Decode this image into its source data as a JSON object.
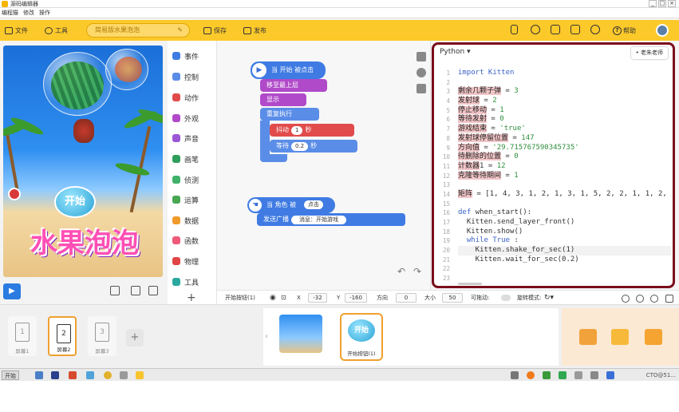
{
  "window": {
    "title": "源码编辑器",
    "buttons": [
      "_",
      "□",
      "×"
    ]
  },
  "menu": [
    "编程猫",
    "修改",
    "操作"
  ],
  "toolbar": {
    "file": "文件",
    "tools": "工具",
    "work_name": "简易版水果泡泡",
    "save": "保存",
    "publish": "发布",
    "help": "帮助"
  },
  "stage": {
    "start_button": "开始",
    "title_art": "水果泡泡"
  },
  "categories": [
    "事件",
    "控制",
    "动作",
    "外观",
    "声音",
    "画笔",
    "侦测",
    "运算",
    "数据",
    "函数",
    "物理",
    "工具"
  ],
  "category_colors": [
    "#3f7be3",
    "#5a8de8",
    "#e14b4b",
    "#b04ac9",
    "#9b58d6",
    "#2e9e5a",
    "#3fb16a",
    "#49a651",
    "#f09a2a",
    "#f05a7a",
    "#e04444",
    "#2aa8a0"
  ],
  "blocks": {
    "group1": {
      "hat": "当 开始 被点击",
      "b1": "移至最上层",
      "b2": "显示",
      "b3": "重复执行",
      "shake": "抖动",
      "shake_val": "1",
      "sec": "秒",
      "wait": "等待",
      "wait_val": "0.2",
      "wait_sec": "秒"
    },
    "group2": {
      "hat": "当 角色 被",
      "hat_opt": "点击",
      "broadcast": "发送广播",
      "msg": "消息：开始游戏"
    }
  },
  "editor": {
    "language": "Python",
    "tutor": "老朱老师",
    "line_numbers": [
      "1",
      "2",
      "3",
      "4",
      "5",
      "6",
      "7",
      "8",
      "9",
      "10",
      "11",
      "12",
      "13",
      "14",
      "15",
      "16",
      "17",
      "18",
      "19",
      "20",
      "21",
      "22",
      "23"
    ],
    "code": [
      [
        {
          "t": "import Kitten",
          "c": "kw"
        }
      ],
      [],
      [
        {
          "t": "剩余几颗子弹",
          "c": "var"
        },
        {
          "t": " = "
        },
        {
          "t": "3",
          "c": "num"
        }
      ],
      [
        {
          "t": "发射球",
          "c": "var"
        },
        {
          "t": " = "
        },
        {
          "t": "2",
          "c": "num"
        }
      ],
      [
        {
          "t": "停止移动",
          "c": "var"
        },
        {
          "t": " = "
        },
        {
          "t": "1",
          "c": "num"
        }
      ],
      [
        {
          "t": "等待发射",
          "c": "var"
        },
        {
          "t": " = "
        },
        {
          "t": "0",
          "c": "num"
        }
      ],
      [
        {
          "t": "游戏结束",
          "c": "var"
        },
        {
          "t": " = "
        },
        {
          "t": "'true'",
          "c": "str"
        }
      ],
      [
        {
          "t": "发射球停留位置",
          "c": "var"
        },
        {
          "t": " = "
        },
        {
          "t": "147",
          "c": "num"
        }
      ],
      [
        {
          "t": "方向值",
          "c": "var"
        },
        {
          "t": " = "
        },
        {
          "t": "'29.715767590345735'",
          "c": "str"
        }
      ],
      [
        {
          "t": "待删除的位置",
          "c": "var"
        },
        {
          "t": " = "
        },
        {
          "t": "0",
          "c": "num"
        }
      ],
      [
        {
          "t": "计数器",
          "c": "var"
        },
        {
          "t": "1 = "
        },
        {
          "t": "12",
          "c": "num"
        }
      ],
      [
        {
          "t": "克隆等待期间",
          "c": "var"
        },
        {
          "t": " = "
        },
        {
          "t": "1",
          "c": "num"
        }
      ],
      [],
      [
        {
          "t": "矩阵",
          "c": "var"
        },
        {
          "t": " = [1, 4, 3, 1, 2, 1, 3, 1, 5, 2, 2, 1, 1, 2,"
        }
      ],
      [],
      [
        {
          "t": "def ",
          "c": "kw"
        },
        {
          "t": "when_start():"
        }
      ],
      [
        {
          "t": "  Kitten.send_layer_front()"
        }
      ],
      [
        {
          "t": "  Kitten.show()"
        }
      ],
      [
        {
          "t": "  "
        },
        {
          "t": "while True",
          "c": "kw"
        },
        {
          "t": " :"
        }
      ],
      [
        {
          "t": "    Kitten.shake_for_sec(1)"
        }
      ],
      [
        {
          "t": "    Kitten.wait_for_sec(0.2)"
        }
      ],
      [],
      []
    ]
  },
  "sprite_info": {
    "name": "开始按钮(1)",
    "x_label": "X",
    "x": "-32",
    "y_label": "Y",
    "y": "-160",
    "dir_label": "方向",
    "dir": "0",
    "size_label": "大小",
    "size": "50",
    "drag_label": "可拖动:",
    "rotate_label": "旋转模式:"
  },
  "scenes": [
    {
      "num": "1",
      "label": "屏幕1"
    },
    {
      "num": "2",
      "label": "屏幕2"
    },
    {
      "num": "3",
      "label": "屏幕3"
    }
  ],
  "sprites": {
    "button_text": "开始",
    "button_label": "开始按钮(1)"
  },
  "taskbar": {
    "start": "开始",
    "clock": "CTO@51..."
  }
}
